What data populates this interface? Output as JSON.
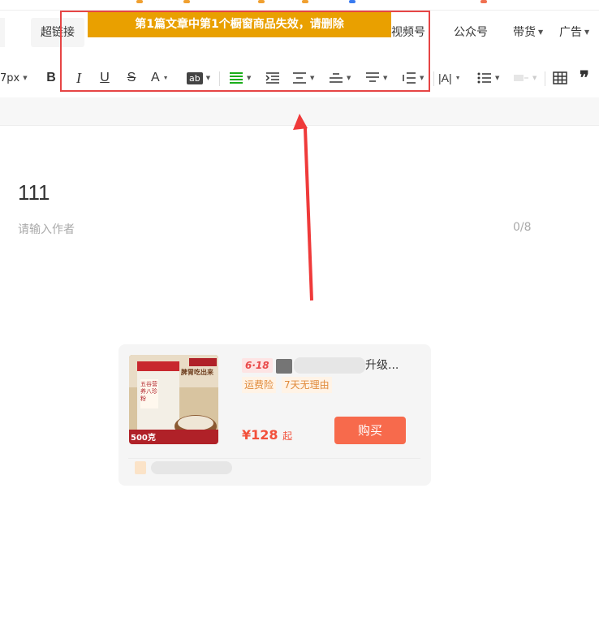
{
  "tabs": {
    "hyperlink": "超链接",
    "video": "视频号",
    "official": "公众号",
    "goods": "带货",
    "ads": "广告"
  },
  "banner": {
    "text": "第1篇文章中第1个橱窗商品失效，请删除"
  },
  "toolbar": {
    "font_size": "7px",
    "bold": "B",
    "italic": "I",
    "underline": "U",
    "strikethrough": "S",
    "font_color": "A",
    "bg_color": "ab"
  },
  "article": {
    "title": "111",
    "author_placeholder": "请输入作者",
    "author_counter": "0/8"
  },
  "product": {
    "promo_badge": "6·18",
    "title_end": "升级...",
    "tags": [
      "运费险",
      "7天无理由"
    ],
    "price": "¥128",
    "price_suffix": "起",
    "buy_label": "购买",
    "image": {
      "headline": "脾胃吃出来",
      "can_label": "五谷营养八珍粉",
      "weight": "500克"
    }
  },
  "colors": {
    "banner": "#e9a000",
    "highlight_border": "#e64545",
    "buy_button": "#f76a4c",
    "price": "#f2503a",
    "tag_text": "#e08a3a"
  }
}
